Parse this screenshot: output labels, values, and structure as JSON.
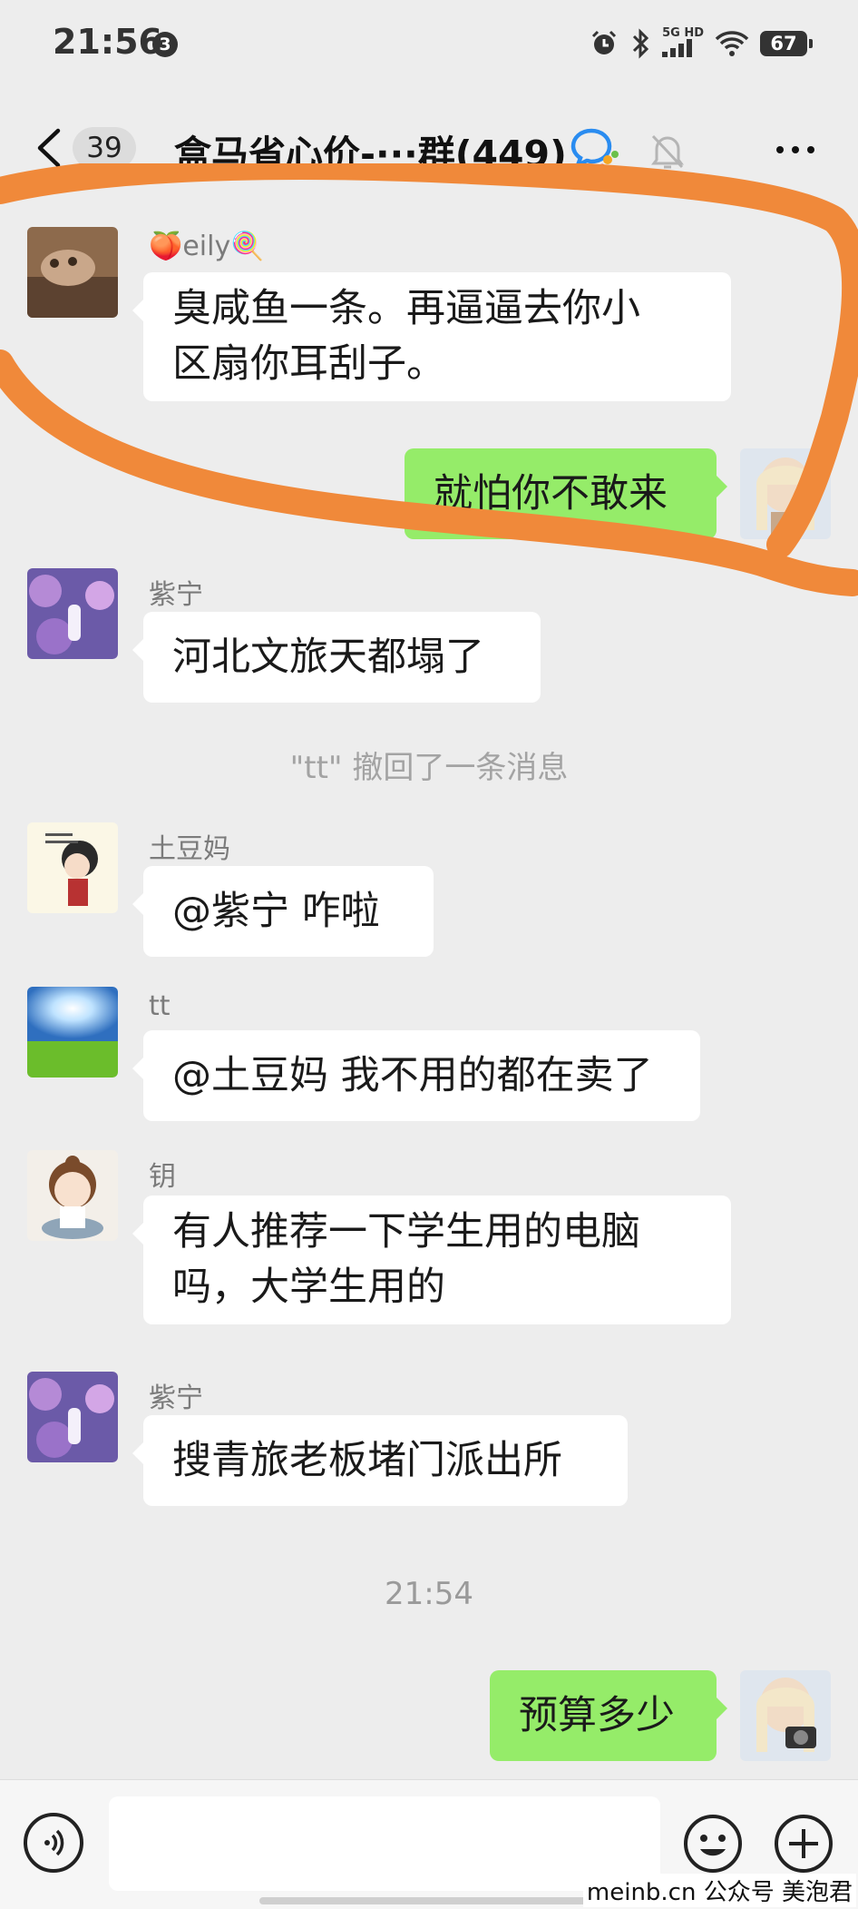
{
  "status_bar": {
    "time": "21:56",
    "notification_count": "3",
    "network": "5G HD",
    "battery": "67"
  },
  "header": {
    "unread_count": "39",
    "title": "盒马省心价-···群(449)"
  },
  "messages": [
    {
      "sender": "🍑eily🍭",
      "text_lines": [
        "臭咸鱼一条。再逼逼去你小",
        "区扇你耳刮子。"
      ]
    },
    {
      "text": "就怕你不敢来"
    },
    {
      "sender": "紫宁",
      "text": "河北文旅天都塌了"
    },
    {
      "system": "\"tt\" 撤回了一条消息"
    },
    {
      "sender": "土豆妈",
      "text": "@紫宁  咋啦"
    },
    {
      "sender": "tt",
      "text": "@土豆妈  我不用的都在卖了"
    },
    {
      "sender": "钥",
      "text_lines": [
        "有人推荐一下学生用的电脑",
        "吗，大学生用的"
      ]
    },
    {
      "sender": "紫宁",
      "text": "搜青旅老板堵门派出所"
    },
    {
      "system": "21:54"
    },
    {
      "text": "预算多少"
    }
  ],
  "watermark": "meinb.cn  公众号 美泡君",
  "colors": {
    "background": "#ededed",
    "outgoing_bubble": "#95ec69",
    "incoming_bubble": "#ffffff",
    "annotation_stroke": "#f0893a"
  },
  "icons": [
    "back-icon",
    "chat-bubble-icon",
    "mute-bell-icon",
    "more-icon",
    "voice-icon",
    "emoji-icon",
    "plus-icon"
  ]
}
